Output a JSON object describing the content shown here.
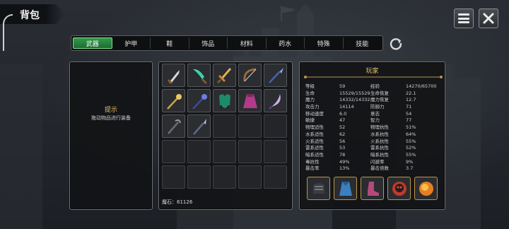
{
  "header": {
    "title": "背包"
  },
  "icons": {
    "menu": "menu-icon",
    "close": "close-icon",
    "refresh": "refresh-icon"
  },
  "tabs": [
    {
      "label": "武器",
      "active": true
    },
    {
      "label": "护甲",
      "active": false
    },
    {
      "label": "鞋",
      "active": false
    },
    {
      "label": "饰品",
      "active": false
    },
    {
      "label": "材料",
      "active": false
    },
    {
      "label": "药水",
      "active": false
    },
    {
      "label": "特殊",
      "active": false
    },
    {
      "label": "技能",
      "active": false
    }
  ],
  "hint": {
    "title": "提示",
    "text": "拖动物品进行装备"
  },
  "inventory": {
    "items": [
      "dagger",
      "jade-blade",
      "golden-sword",
      "wooden-bow",
      "crystal-spear",
      "golden-staff",
      "blue-staff",
      "green-armor",
      "crimson-cape",
      "curved-blade",
      "dark-staff",
      "iron-spear"
    ],
    "currency_label": "魔石：61126"
  },
  "player": {
    "title": "玩家",
    "stats": [
      [
        "等级",
        "59",
        "经验",
        "14270/65700"
      ],
      [
        "生命",
        "15529/15529",
        "生命恢复",
        "22.1"
      ],
      [
        "魔力",
        "14332/14332",
        "魔力恢复",
        "12.7"
      ],
      [
        "攻击力",
        "14114",
        "防御力",
        "71"
      ],
      [
        "移动速度",
        "6.0",
        "意志",
        "54"
      ],
      [
        "敏捷",
        "47",
        "智力",
        "77"
      ],
      [
        "物理适性",
        "52",
        "物理抗性",
        "51%"
      ],
      [
        "水系适性",
        "62",
        "水系抗性",
        "64%"
      ],
      [
        "火系适性",
        "56",
        "火系抗性",
        "55%"
      ],
      [
        "雷系适性",
        "53",
        "雷系抗性",
        "52%"
      ],
      [
        "暗系适性",
        "78",
        "暗系抗性",
        "55%"
      ],
      [
        "毒抗性",
        "49%",
        "闪避率",
        "9%"
      ],
      [
        "暴击率",
        "13%",
        "暴击倍数",
        "3.7"
      ]
    ],
    "equipment": [
      "gauntlet-icon",
      "cape-icon",
      "boots-icon",
      "skull-amulet-icon",
      "fire-orb-icon"
    ]
  },
  "colors": {
    "accent": "#2f9a4a",
    "gold": "#e8c36a",
    "panel": "#121316"
  }
}
